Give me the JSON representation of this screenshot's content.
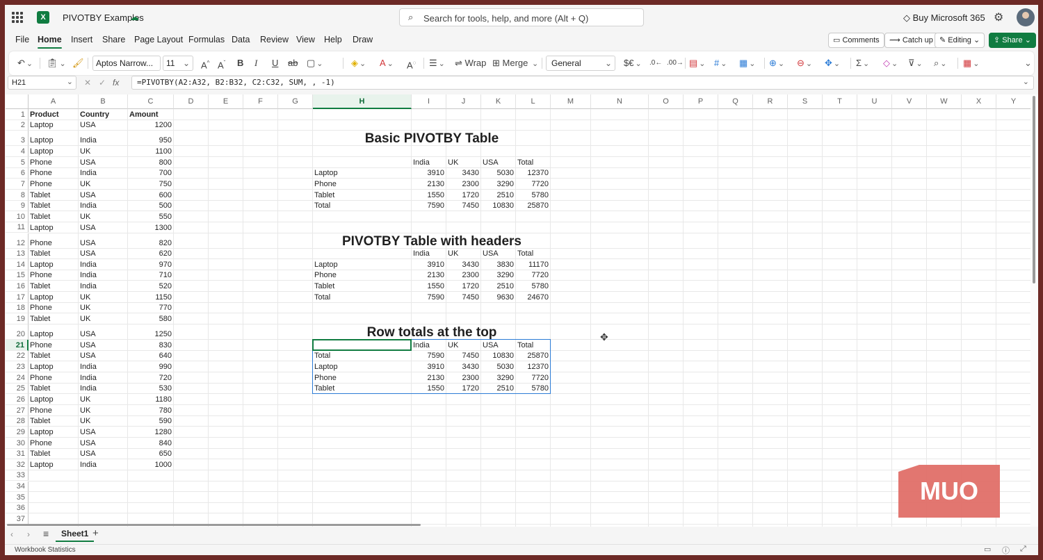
{
  "titlebar": {
    "app_name": "PIVOTBY Examples",
    "search_placeholder": "Search for tools, help, and more (Alt + Q)",
    "buy": "Buy Microsoft 365"
  },
  "menu": {
    "items": [
      "File",
      "Home",
      "Insert",
      "Share",
      "Page Layout",
      "Formulas",
      "Data",
      "Review",
      "View",
      "Help",
      "Draw"
    ],
    "active": "Home",
    "comments": "Comments",
    "catch_up": "Catch up",
    "editing": "Editing",
    "share": "Share"
  },
  "ribbon": {
    "font_name": "Aptos Narrow...",
    "font_size": "11",
    "wrap": "Wrap",
    "merge": "Merge",
    "number_format": "General"
  },
  "formula_bar": {
    "name_box": "H21",
    "formula": "=PIVOTBY(A2:A32, B2:B32, C2:C32, SUM, , -1)"
  },
  "grid": {
    "columns": [
      "A",
      "B",
      "C",
      "D",
      "E",
      "F",
      "G",
      "H",
      "I",
      "J",
      "K",
      "L",
      "M",
      "N",
      "O",
      "P",
      "Q",
      "R",
      "S",
      "T",
      "U",
      "V",
      "W",
      "X",
      "Y"
    ],
    "selected_column": "H",
    "selected_row": 21,
    "source_headers": [
      "Product",
      "Country",
      "Amount"
    ],
    "source_rows": [
      [
        "Laptop",
        "USA",
        1200
      ],
      [
        "Laptop",
        "India",
        950
      ],
      [
        "Laptop",
        "UK",
        1100
      ],
      [
        "Phone",
        "USA",
        800
      ],
      [
        "Phone",
        "India",
        700
      ],
      [
        "Phone",
        "UK",
        750
      ],
      [
        "Tablet",
        "USA",
        600
      ],
      [
        "Tablet",
        "India",
        500
      ],
      [
        "Tablet",
        "UK",
        550
      ],
      [
        "Laptop",
        "USA",
        1300
      ],
      [
        "Phone",
        "USA",
        820
      ],
      [
        "Tablet",
        "USA",
        620
      ],
      [
        "Laptop",
        "India",
        970
      ],
      [
        "Phone",
        "India",
        710
      ],
      [
        "Tablet",
        "India",
        520
      ],
      [
        "Laptop",
        "UK",
        1150
      ],
      [
        "Phone",
        "UK",
        770
      ],
      [
        "Tablet",
        "UK",
        580
      ],
      [
        "Laptop",
        "USA",
        1250
      ],
      [
        "Phone",
        "USA",
        830
      ],
      [
        "Tablet",
        "USA",
        640
      ],
      [
        "Laptop",
        "India",
        990
      ],
      [
        "Phone",
        "India",
        720
      ],
      [
        "Tablet",
        "India",
        530
      ],
      [
        "Laptop",
        "UK",
        1180
      ],
      [
        "Phone",
        "UK",
        780
      ],
      [
        "Tablet",
        "UK",
        590
      ],
      [
        "Laptop",
        "USA",
        1280
      ],
      [
        "Phone",
        "USA",
        840
      ],
      [
        "Tablet",
        "USA",
        650
      ],
      [
        "Laptop",
        "India",
        1000
      ]
    ],
    "pivots": [
      {
        "title": "Basic PIVOTBY Table",
        "headers": [
          "",
          "India",
          "UK",
          "USA",
          "Total"
        ],
        "rows": [
          [
            "Laptop",
            3910,
            3430,
            5030,
            12370
          ],
          [
            "Phone",
            2130,
            2300,
            3290,
            7720
          ],
          [
            "Tablet",
            1550,
            1720,
            2510,
            5780
          ],
          [
            "Total",
            7590,
            7450,
            10830,
            25870
          ]
        ]
      },
      {
        "title": "PIVOTBY Table with headers",
        "headers": [
          "",
          "India",
          "UK",
          "USA",
          "Total"
        ],
        "rows": [
          [
            "Laptop",
            3910,
            3430,
            3830,
            11170
          ],
          [
            "Phone",
            2130,
            2300,
            3290,
            7720
          ],
          [
            "Tablet",
            1550,
            1720,
            2510,
            5780
          ],
          [
            "Total",
            7590,
            7450,
            9630,
            24670
          ]
        ]
      },
      {
        "title": "Row totals at the top",
        "headers": [
          "",
          "India",
          "UK",
          "USA",
          "Total"
        ],
        "rows": [
          [
            "Total",
            7590,
            7450,
            10830,
            25870
          ],
          [
            "Laptop",
            3910,
            3430,
            5030,
            12370
          ],
          [
            "Phone",
            2130,
            2300,
            3290,
            7720
          ],
          [
            "Tablet",
            1550,
            1720,
            2510,
            5780
          ]
        ]
      }
    ]
  },
  "sheets": {
    "tabs": [
      "Sheet1"
    ],
    "active": "Sheet1"
  },
  "statusbar": {
    "text": "Workbook Statistics"
  },
  "watermark": {
    "text": "MUO"
  },
  "colors": {
    "accent": "#107c41",
    "selection": "#2b7bd6"
  }
}
